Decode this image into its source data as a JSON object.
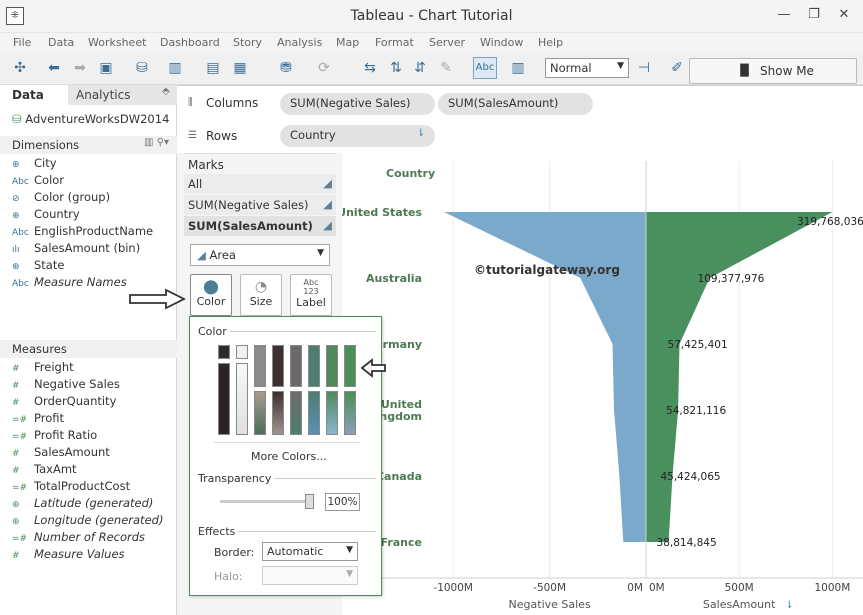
{
  "window": {
    "title": "Tableau - Chart Tutorial",
    "minimize": "—",
    "restore": "❐",
    "close": "✕"
  },
  "menu": [
    "File",
    "Data",
    "Worksheet",
    "Dashboard",
    "Story",
    "Analysis",
    "Map",
    "Format",
    "Server",
    "Window",
    "Help"
  ],
  "toolbar": {
    "fit_value": "Normal",
    "show_me": "Show Me",
    "abc": "Abc"
  },
  "data_pane": {
    "tab_data": "Data",
    "tab_analytics": "Analytics",
    "datasource": "AdventureWorksDW2014",
    "dimensions_header": "Dimensions",
    "dimensions": [
      {
        "icon": "globe-icon",
        "type": "⊕",
        "name": "City"
      },
      {
        "icon": "abc-icon",
        "type": "Abc",
        "name": "Color"
      },
      {
        "icon": "paperclip-icon",
        "type": "⊘",
        "name": "Color (group)"
      },
      {
        "icon": "globe-icon",
        "type": "⊕",
        "name": "Country"
      },
      {
        "icon": "abc-icon",
        "type": "Abc",
        "name": "EnglishProductName"
      },
      {
        "icon": "bin-icon",
        "type": "ılı",
        "name": "SalesAmount (bin)"
      },
      {
        "icon": "globe-icon",
        "type": "⊕",
        "name": "State"
      },
      {
        "icon": "abc-icon",
        "type": "Abc",
        "name": "Measure Names"
      }
    ],
    "measures_header": "Measures",
    "measures": [
      {
        "type": "#",
        "name": "Freight"
      },
      {
        "type": "#",
        "name": "Negative Sales"
      },
      {
        "type": "#",
        "name": "OrderQuantity"
      },
      {
        "type": "=#",
        "name": "Profit"
      },
      {
        "type": "=#",
        "name": "Profit Ratio"
      },
      {
        "type": "#",
        "name": "SalesAmount"
      },
      {
        "type": "#",
        "name": "TaxAmt"
      },
      {
        "type": "=#",
        "name": "TotalProductCost"
      },
      {
        "type": "⊕",
        "name": "Latitude (generated)"
      },
      {
        "type": "⊕",
        "name": "Longitude (generated)"
      },
      {
        "type": "=#",
        "name": "Number of Records"
      },
      {
        "type": "#",
        "name": "Measure Values"
      }
    ]
  },
  "shelves": {
    "columns_label": "Columns",
    "columns_pills": [
      "SUM(Negative Sales)",
      "SUM(SalesAmount)"
    ],
    "rows_label": "Rows",
    "rows_pills": [
      "Country"
    ]
  },
  "marks": {
    "header": "Marks",
    "cards": [
      "All",
      "SUM(Negative Sales)",
      "SUM(SalesAmount)"
    ],
    "mark_type": "Area",
    "buttons": {
      "color": "Color",
      "size": "Size",
      "label": "Label",
      "label_icon": "Abc\n123"
    }
  },
  "color_popup": {
    "title": "Color",
    "more_colors": "More Colors...",
    "transparency_label": "Transparency",
    "transparency_value": "100%",
    "transparency_level": 1.0,
    "effects_label": "Effects",
    "border_label": "Border:",
    "border_value": "Automatic",
    "halo_label": "Halo:",
    "swatches": [
      "#2b2b2b",
      "#f0f0f0",
      "#8b8b8b",
      "#3d3030",
      "#6f6a6a",
      "#4c7d70",
      "#4e8a5c",
      "#4a8f55"
    ]
  },
  "watermark": "©tutorialgateway.org",
  "chart_data": {
    "type": "area",
    "axis_title": "Country",
    "categories": [
      "United States",
      "Australia",
      "Germany",
      "United Kingdom",
      "Canada",
      "France"
    ],
    "series": [
      {
        "name": "Negative Sales",
        "color": "#7ba9cc",
        "values": [
          -1048000000,
          -341000000,
          -174000000,
          -166000000,
          -138000000,
          -118000000
        ]
      },
      {
        "name": "SalesAmount",
        "color": "#4a8f5e",
        "values": [
          1000000000,
          341000000,
          180000000,
          172000000,
          142000000,
          121000000
        ]
      }
    ],
    "data_labels": [
      "319,768,036",
      "109,377,976",
      "57,425,401",
      "54,821,116",
      "45,424,065",
      "38,814,845"
    ],
    "x_ticks_left": [
      "-1000M",
      "-500M",
      "0M"
    ],
    "x_ticks_right": [
      "0M",
      "500M",
      "1000M"
    ],
    "xlabel_left": "Negative Sales",
    "xlabel_right": "SalesAmount",
    "xlim_left": [
      -1110000000,
      0
    ],
    "xlim_right": [
      0,
      1100000000
    ]
  }
}
